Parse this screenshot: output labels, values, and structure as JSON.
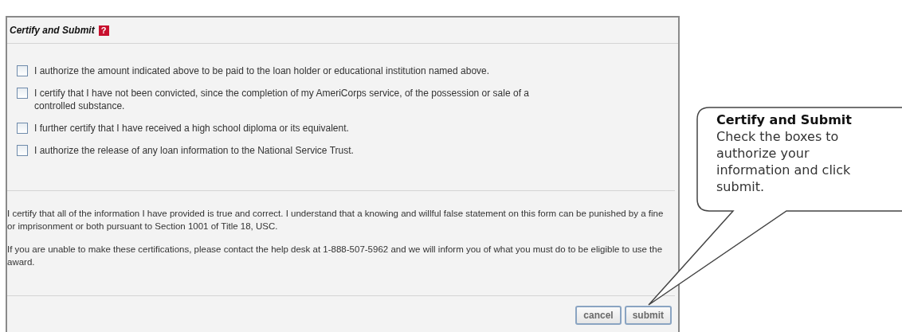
{
  "panel": {
    "title": "Certify and Submit",
    "help_icon": "?",
    "certifications": [
      {
        "label": "I authorize the amount indicated above to be paid to the loan holder or educational institution named above.",
        "checked": false
      },
      {
        "label": "I certify that I have not been convicted, since the completion of my AmeriCorps service, of the possession or sale of a controlled substance.",
        "checked": false
      },
      {
        "label": "I further certify that I have received a high school diploma or its equivalent.",
        "checked": false
      },
      {
        "label": "I authorize the release of any loan information to the National Service Trust.",
        "checked": false
      }
    ],
    "statements": [
      "I certify that all of the information I have provided is true and correct. I understand that a knowing and willful false statement on this form can be punished by a fine or imprisonment or both pursuant to Section 1001 of Title 18, USC.",
      "If you are unable to make these certifications, please contact the help desk at 1-888-507-5962 and we will inform you of what you must do to be eligible to use the award."
    ],
    "buttons": [
      "cancel",
      "submit"
    ]
  },
  "callout": {
    "title": "Certify and Submit",
    "text": "Check the boxes to authorize your information and click submit."
  }
}
